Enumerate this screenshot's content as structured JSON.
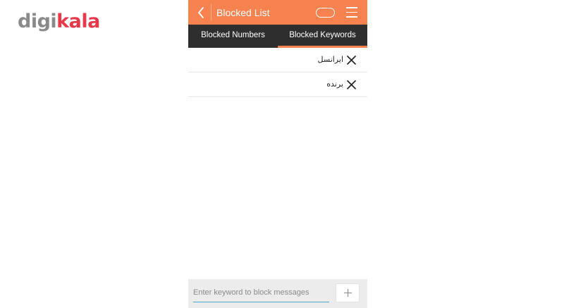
{
  "brand": {
    "logo_part1": "digi",
    "logo_part2": "kala"
  },
  "appbar": {
    "title": "Blocked List",
    "back_icon": "chevron-left-icon",
    "toggle_icon": "pill-toggle-icon",
    "menu_icon": "hamburger-menu-icon"
  },
  "tabs": [
    {
      "label": "Blocked Numbers",
      "active": false
    },
    {
      "label": "Blocked Keywords",
      "active": true
    }
  ],
  "keywords": [
    {
      "text": "ایرانسل",
      "remove_icon": "close-icon"
    },
    {
      "text": "برنده",
      "remove_icon": "close-icon"
    }
  ],
  "input": {
    "value": "",
    "placeholder": "Enter keyword to block messages",
    "add_icon": "plus-icon"
  },
  "colors": {
    "accent": "#f5824f",
    "tab_bar": "#2e2e2e",
    "input_underline": "#4aa6c9",
    "brand_gray": "#8a8a8a",
    "brand_red": "#e63a4a"
  }
}
